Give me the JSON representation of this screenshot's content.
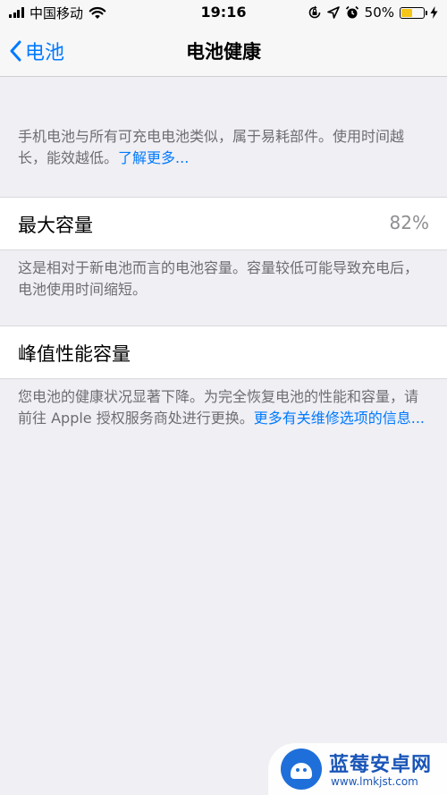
{
  "status_bar": {
    "carrier": "中国移动",
    "time": "19:16",
    "battery_percent": "50%",
    "battery_level": 0.5
  },
  "nav": {
    "back_label": "电池",
    "title": "电池健康"
  },
  "intro": {
    "text": "手机电池与所有可充电电池类似，属于易耗部件。使用时间越长，能效越低。",
    "link": "了解更多..."
  },
  "max_capacity": {
    "label": "最大容量",
    "value": "82%",
    "description": "这是相对于新电池而言的电池容量。容量较低可能导致充电后，电池使用时间缩短。"
  },
  "peak_performance": {
    "label": "峰值性能容量",
    "description": "您电池的健康状况显著下降。为完全恢复电池的性能和容量，请前往 Apple 授权服务商处进行更换。",
    "link": "更多有关维修选项的信息..."
  },
  "watermark": {
    "name": "蓝莓安卓网",
    "url": "www.lmkjst.com"
  },
  "colors": {
    "accent": "#007aff",
    "background": "#efeff4",
    "battery_fill": "#f5c518"
  }
}
